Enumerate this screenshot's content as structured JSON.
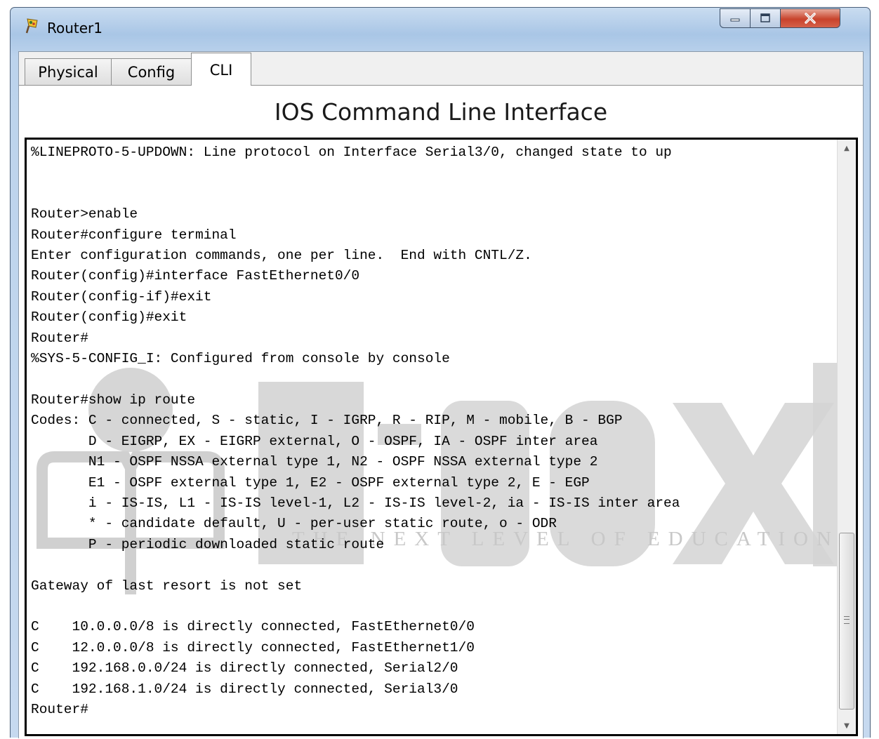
{
  "window": {
    "title": "Router1",
    "controls": {
      "minimize_icon": "minimize-icon",
      "maximize_icon": "maximize-icon",
      "close_icon": "close-icon"
    }
  },
  "tabs": [
    {
      "label": "Physical",
      "active": false
    },
    {
      "label": "Config",
      "active": false
    },
    {
      "label": "CLI",
      "active": true
    }
  ],
  "heading": "IOS Command Line Interface",
  "console": {
    "lines": [
      "%LINEPROTO-5-UPDOWN: Line protocol on Interface Serial3/0, changed state to up",
      "",
      "",
      "Router>enable",
      "Router#configure terminal",
      "Enter configuration commands, one per line.  End with CNTL/Z.",
      "Router(config)#interface FastEthernet0/0",
      "Router(config-if)#exit",
      "Router(config)#exit",
      "Router#",
      "%SYS-5-CONFIG_I: Configured from console by console",
      "",
      "Router#show ip route",
      "Codes: C - connected, S - static, I - IGRP, R - RIP, M - mobile, B - BGP",
      "       D - EIGRP, EX - EIGRP external, O - OSPF, IA - OSPF inter area",
      "       N1 - OSPF NSSA external type 1, N2 - OSPF NSSA external type 2",
      "       E1 - OSPF external type 1, E2 - OSPF external type 2, E - EGP",
      "       i - IS-IS, L1 - IS-IS level-1, L2 - IS-IS level-2, ia - IS-IS inter area",
      "       * - candidate default, U - per-user static route, o - ODR",
      "       P - periodic downloaded static route",
      "",
      "Gateway of last resort is not set",
      "",
      "C    10.0.0.0/8 is directly connected, FastEthernet0/0",
      "C    12.0.0.0/8 is directly connected, FastEthernet1/0",
      "C    192.168.0.0/24 is directly connected, Serial2/0",
      "C    192.168.1.0/24 is directly connected, Serial3/0",
      "Router#"
    ]
  },
  "watermark": {
    "brand": "E-next",
    "tagline": "THE NEXT LEVEL OF EDUCATION",
    "color": "#c8c8c8"
  },
  "colors": {
    "titlebar": "#a9c6e6",
    "close_button": "#c8432c",
    "console_border": "#000000"
  }
}
